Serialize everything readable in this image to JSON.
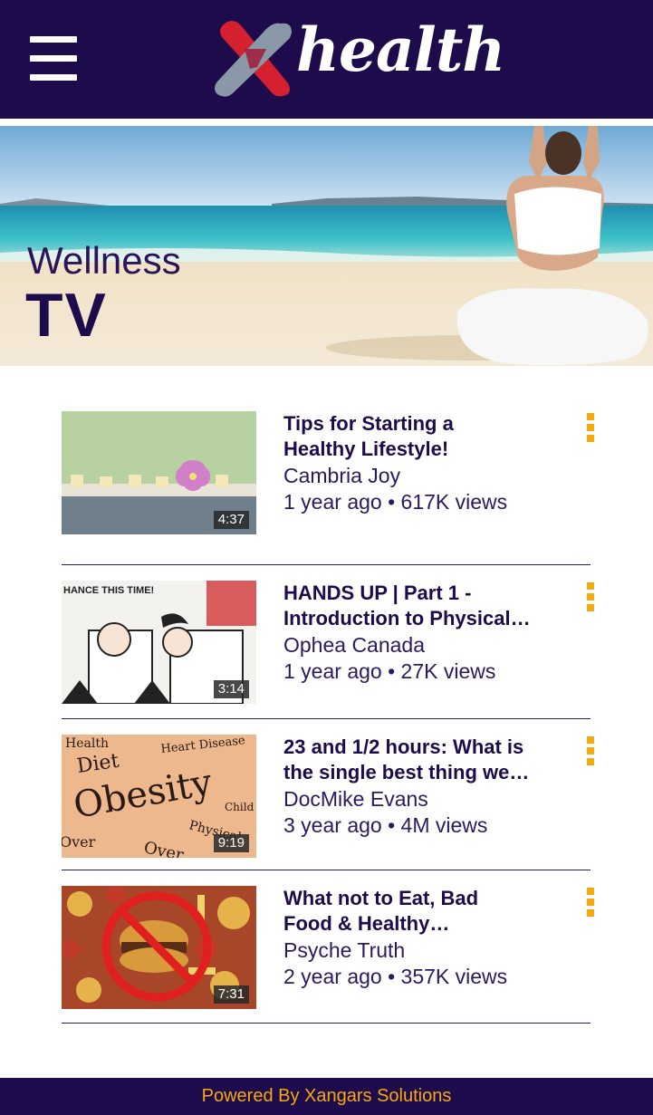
{
  "header": {
    "menu_icon": "hamburger-menu-icon",
    "logo_text": "health",
    "logo_mark": "X",
    "background": "#1e0b4c"
  },
  "hero": {
    "subtitle": "Wellness",
    "title": "TV"
  },
  "videos": [
    {
      "title_line1": "Tips for Starting a",
      "title_line2": "Healthy Lifestyle!",
      "channel": "Cambria Joy",
      "meta": "1 year ago • 617K views",
      "duration": "4:37"
    },
    {
      "title_line1": "HANDS UP | Part 1 -",
      "title_line2": "Introduction to Physical…",
      "channel": "Ophea Canada",
      "meta": "1 year ago • 27K views",
      "duration": "3:14",
      "thumb_caption": "HANCE THIS TIME!"
    },
    {
      "title_line1": "23 and 1/2 hours: What is",
      "title_line2": "the single best thing we…",
      "channel": "DocMike Evans",
      "meta": "3 year ago • 4M views",
      "duration": "9:19",
      "thumb_words": {
        "health": "Health",
        "heart_disease": "Heart Disease",
        "diet": "Diet",
        "obesity": "Obesity",
        "child": "Child",
        "physical": "Physical",
        "over_left": "Over",
        "over_bottom": "Over"
      }
    },
    {
      "title_line1": "What not to Eat, Bad",
      "title_line2": "Food & Healthy…",
      "channel": "Psyche Truth",
      "meta": "2 year ago • 357K views",
      "duration": "7:31"
    }
  ],
  "more_icon": "more-vertical-icon",
  "footer": {
    "text": "Powered By Xangars Solutions"
  },
  "colors": {
    "navy": "#1e0b4c",
    "accent": "#f5a90e",
    "logo_red": "#d4202f",
    "logo_grey": "#8a97a6"
  }
}
